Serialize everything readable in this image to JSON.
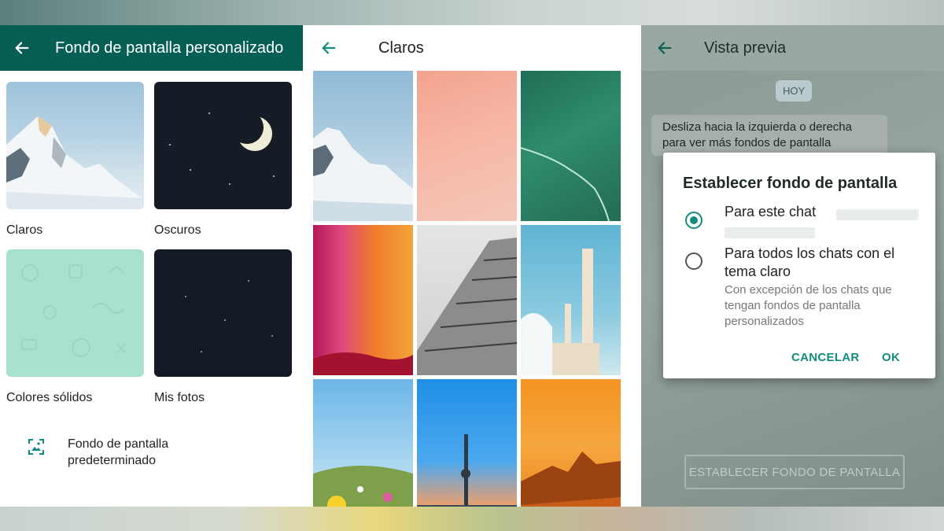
{
  "panel1": {
    "title": "Fondo de pantalla personalizado",
    "categories": [
      {
        "label": "Claros"
      },
      {
        "label": "Oscuros"
      },
      {
        "label": "Colores sólidos"
      },
      {
        "label": "Mis fotos"
      }
    ],
    "default_wallpaper_label": "Fondo de pantalla predeterminado"
  },
  "panel2": {
    "title": "Claros"
  },
  "panel3": {
    "title": "Vista previa",
    "date_chip": "HOY",
    "hint_bubble": "Desliza hacia la izquierda o derecha para ver más fondos de pantalla",
    "dialog": {
      "title": "Establecer fondo de pantalla",
      "option1": "Para este chat",
      "option2": "Para todos los chats con el tema claro",
      "option2_sub": "Con excepción de los chats que tengan fondos de pantalla personalizados",
      "selected": "option1",
      "cancel": "CANCELAR",
      "ok": "OK"
    },
    "set_button": "ESTABLECER FONDO DE PANTALLA"
  },
  "colors": {
    "header_green": "#075e54",
    "accent_teal": "#128c7e"
  },
  "icons": {
    "back": "arrow-left-icon",
    "default_wallpaper": "wallpaper-icon"
  }
}
